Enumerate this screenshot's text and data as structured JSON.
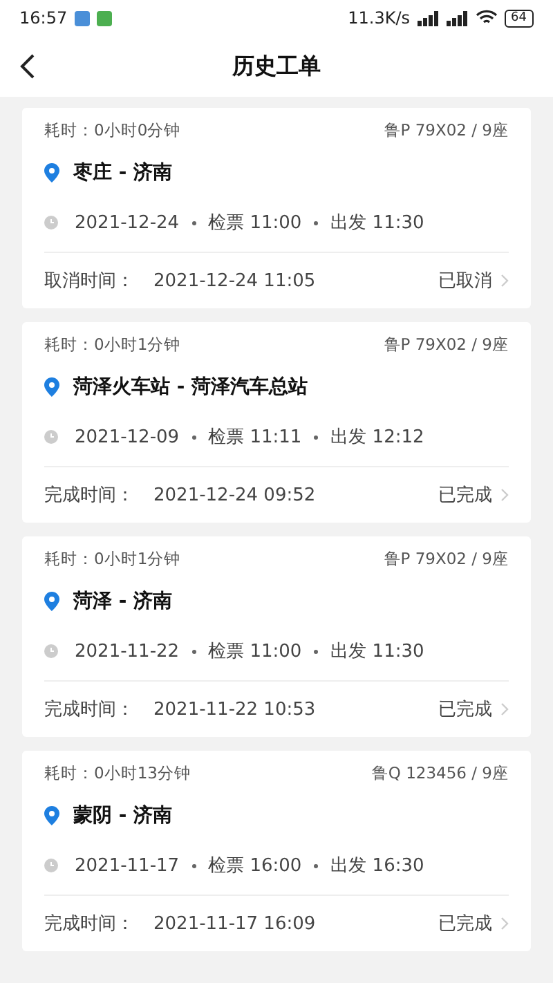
{
  "status_bar": {
    "time": "16:57",
    "speed": "11.3K/s",
    "battery": "64"
  },
  "header": {
    "title": "历史工单"
  },
  "orders": [
    {
      "duration": "耗时：0小时0分钟",
      "vehicle": "鲁P 79X02 / 9座",
      "route": "枣庄 - 济南",
      "date": "2021-12-24",
      "checkin": "检票 11:00",
      "depart": "出发 11:30",
      "time_label": "取消时间：",
      "time_value": "2021-12-24 11:05",
      "status": "已取消"
    },
    {
      "duration": "耗时：0小时1分钟",
      "vehicle": "鲁P 79X02 / 9座",
      "route": "菏泽火车站 - 菏泽汽车总站",
      "date": "2021-12-09",
      "checkin": "检票 11:11",
      "depart": "出发 12:12",
      "time_label": "完成时间：",
      "time_value": "2021-12-24 09:52",
      "status": "已完成"
    },
    {
      "duration": "耗时：0小时1分钟",
      "vehicle": "鲁P 79X02 / 9座",
      "route": "菏泽 - 济南",
      "date": "2021-11-22",
      "checkin": "检票 11:00",
      "depart": "出发 11:30",
      "time_label": "完成时间：",
      "time_value": "2021-11-22 10:53",
      "status": "已完成"
    },
    {
      "duration": "耗时：0小时13分钟",
      "vehicle": "鲁Q 123456 / 9座",
      "route": "蒙阴 - 济南",
      "date": "2021-11-17",
      "checkin": "检票 16:00",
      "depart": "出发 16:30",
      "time_label": "完成时间：",
      "time_value": "2021-11-17 16:09",
      "status": "已完成"
    }
  ]
}
